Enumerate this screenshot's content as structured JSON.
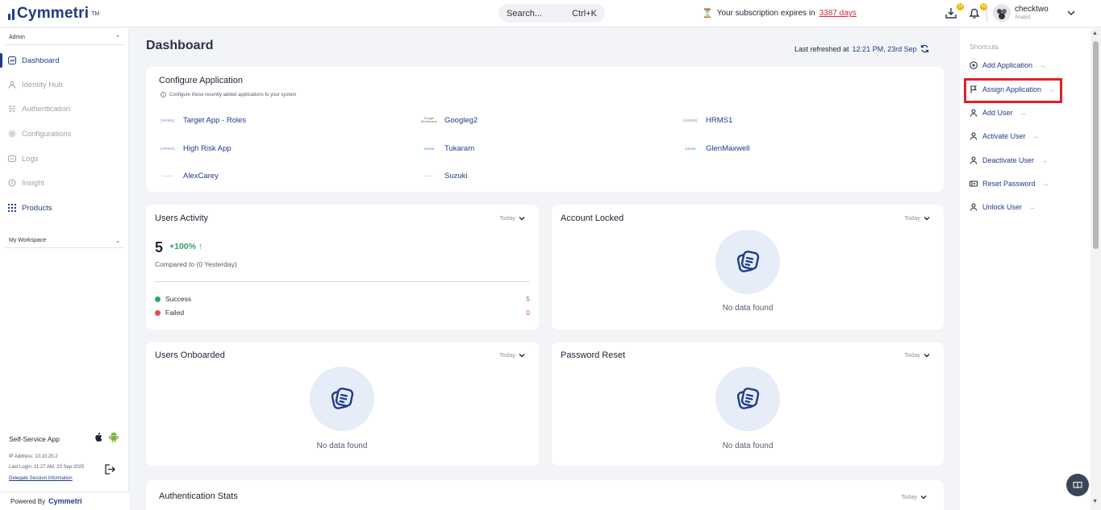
{
  "topbar": {
    "logo_text": "Cymmetri",
    "logo_tm": "TM",
    "search_placeholder": "Search...",
    "search_shortcut": "Ctrl+K",
    "subscription_prefix": "Your subscription expires in",
    "subscription_days": "3387 days",
    "download_badge": "14",
    "notification_badge": "99",
    "user_name": "checktwo",
    "user_role": "Analyst"
  },
  "sidebar": {
    "admin_label": "Admin",
    "items": [
      {
        "label": "Dashboard",
        "icon": "dashboard-icon"
      },
      {
        "label": "Identity Hub",
        "icon": "identity-icon"
      },
      {
        "label": "Authentication",
        "icon": "authentication-icon"
      },
      {
        "label": "Configurations",
        "icon": "gear-icon"
      },
      {
        "label": "Logs",
        "icon": "logs-icon"
      },
      {
        "label": "Insight",
        "icon": "insight-icon"
      },
      {
        "label": "Products",
        "icon": "grid-icon"
      }
    ],
    "workspace_label": "My Workspace",
    "self_service_label": "Self-Service App",
    "ip_address": "IP Address: 10.10.20.2",
    "last_login": "Last Login: 11:27 AM, 23 Sep 2025",
    "delegate_link": "Delegate Session Information",
    "powered_by": "Powered By",
    "powered_logo": "Cymmetri"
  },
  "main": {
    "title": "Dashboard",
    "last_refreshed_label": "Last refreshed at",
    "last_refreshed_time": "12:21 PM, 23rd Sep",
    "configure": {
      "title": "Configure Application",
      "subtitle": "Configure these recently added applications to your system",
      "apps": [
        {
          "name": "Target App - Roles",
          "logo": "[HRMS]"
        },
        {
          "name": "Googleg2",
          "logo": "Google Workspace"
        },
        {
          "name": "HRMS1",
          "logo": "[HRMS]"
        },
        {
          "name": "High Risk App",
          "logo": "[HRMS]"
        },
        {
          "name": "Tukaram",
          "logo": "Azure"
        },
        {
          "name": "GlenMaxwell",
          "logo": "Azure"
        },
        {
          "name": "AlexCarey",
          "logo": "———"
        },
        {
          "name": "Suzuki",
          "logo": "——"
        }
      ]
    },
    "users_activity": {
      "title": "Users Activity",
      "period": "Today",
      "count": "5",
      "change": "+100%",
      "compared": "Compared to (0 Yesterday)",
      "success_label": "Success",
      "success_value": "5",
      "failed_label": "Failed",
      "failed_value": "0"
    },
    "account_locked": {
      "title": "Account Locked",
      "period": "Today",
      "empty": "No data found"
    },
    "users_onboarded": {
      "title": "Users Onboarded",
      "period": "Today",
      "empty": "No data found"
    },
    "password_reset": {
      "title": "Password Reset",
      "period": "Today",
      "empty": "No data found"
    },
    "auth_stats": {
      "title": "Authentication Stats",
      "period": "Today"
    }
  },
  "shortcuts": {
    "header": "Shortcuts",
    "items": [
      {
        "label": "Add Application",
        "icon": "plus-circle-icon"
      },
      {
        "label": "Assign Application",
        "icon": "flag-icon"
      },
      {
        "label": "Add User",
        "icon": "user-icon"
      },
      {
        "label": "Activate User",
        "icon": "user-icon"
      },
      {
        "label": "Deactivate User",
        "icon": "user-icon"
      },
      {
        "label": "Reset Password",
        "icon": "key-icon"
      },
      {
        "label": "Unlock User",
        "icon": "user-icon"
      }
    ]
  },
  "colors": {
    "brand": "#1f3c88",
    "success": "#2fa36b",
    "failed": "#e04b5a",
    "highlight": "#e0202b"
  }
}
